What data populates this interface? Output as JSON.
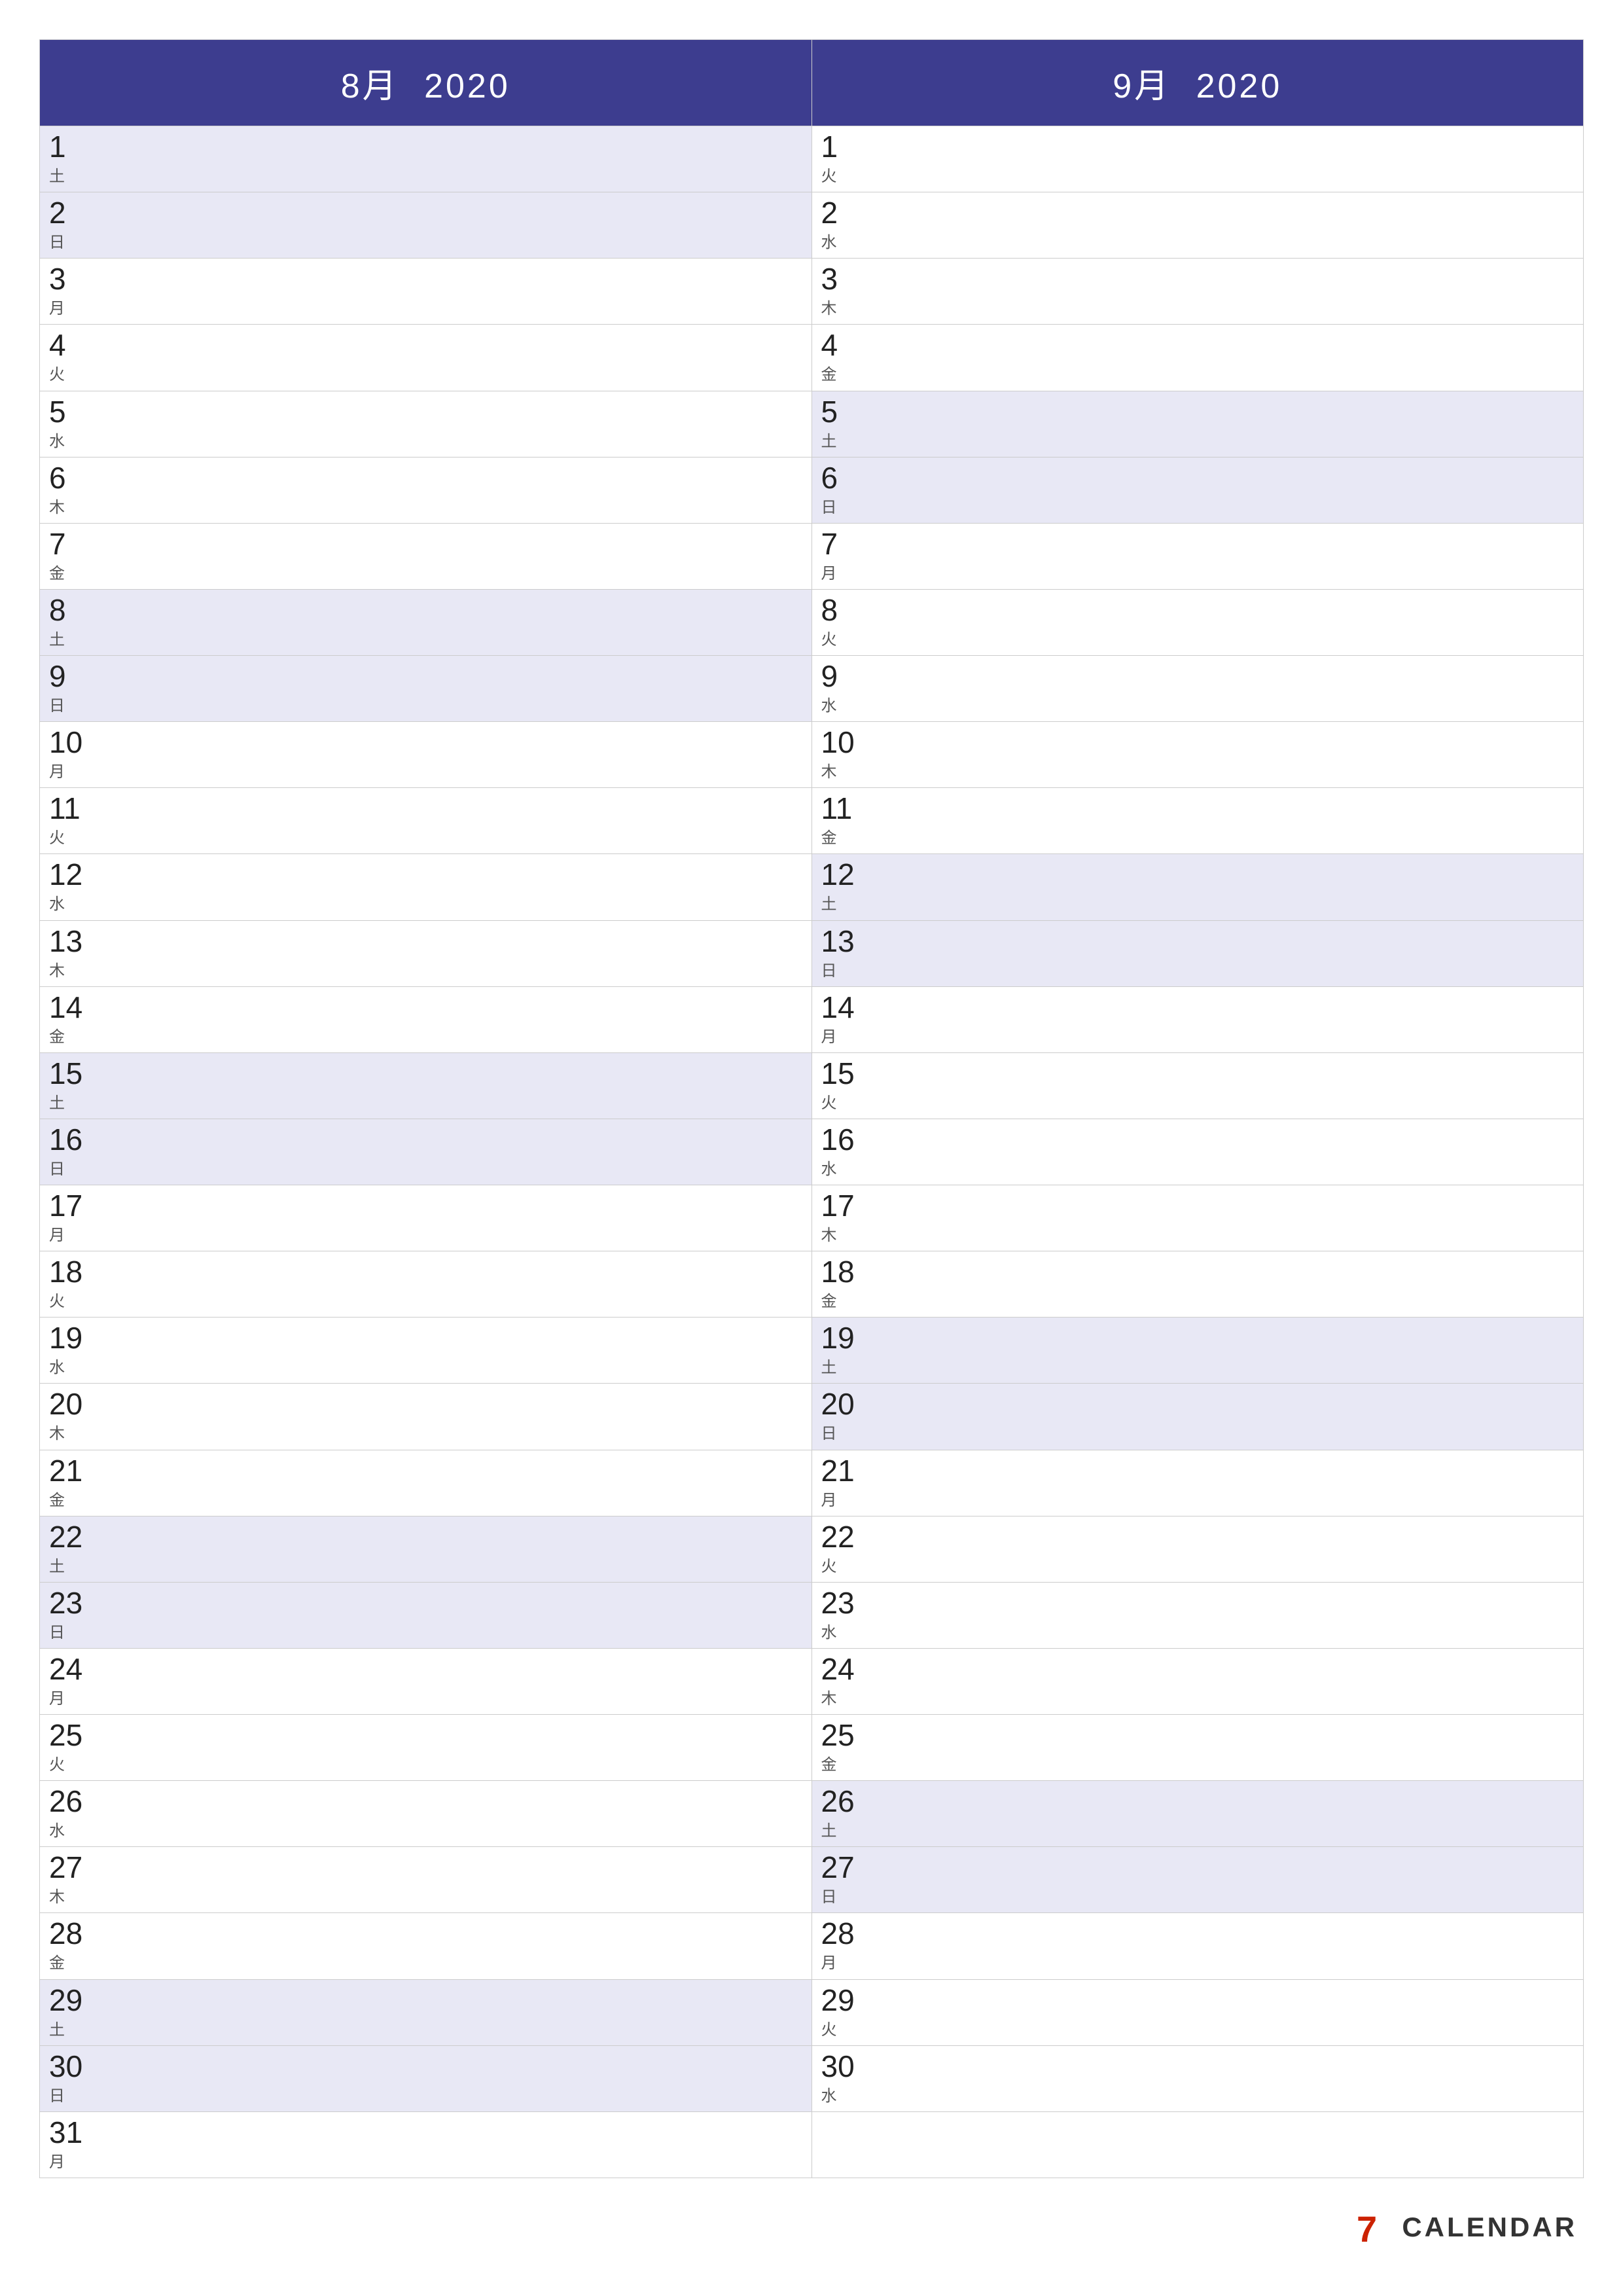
{
  "months": [
    {
      "label": "8月",
      "year": "2020",
      "days": [
        {
          "num": "1",
          "jp": "土",
          "weekend": true
        },
        {
          "num": "2",
          "jp": "日",
          "weekend": true
        },
        {
          "num": "3",
          "jp": "月",
          "weekend": false
        },
        {
          "num": "4",
          "jp": "火",
          "weekend": false
        },
        {
          "num": "5",
          "jp": "水",
          "weekend": false
        },
        {
          "num": "6",
          "jp": "木",
          "weekend": false
        },
        {
          "num": "7",
          "jp": "金",
          "weekend": false
        },
        {
          "num": "8",
          "jp": "土",
          "weekend": true
        },
        {
          "num": "9",
          "jp": "日",
          "weekend": true
        },
        {
          "num": "10",
          "jp": "月",
          "weekend": false
        },
        {
          "num": "11",
          "jp": "火",
          "weekend": false
        },
        {
          "num": "12",
          "jp": "水",
          "weekend": false
        },
        {
          "num": "13",
          "jp": "木",
          "weekend": false
        },
        {
          "num": "14",
          "jp": "金",
          "weekend": false
        },
        {
          "num": "15",
          "jp": "土",
          "weekend": true
        },
        {
          "num": "16",
          "jp": "日",
          "weekend": true
        },
        {
          "num": "17",
          "jp": "月",
          "weekend": false
        },
        {
          "num": "18",
          "jp": "火",
          "weekend": false
        },
        {
          "num": "19",
          "jp": "水",
          "weekend": false
        },
        {
          "num": "20",
          "jp": "木",
          "weekend": false
        },
        {
          "num": "21",
          "jp": "金",
          "weekend": false
        },
        {
          "num": "22",
          "jp": "土",
          "weekend": true
        },
        {
          "num": "23",
          "jp": "日",
          "weekend": true
        },
        {
          "num": "24",
          "jp": "月",
          "weekend": false
        },
        {
          "num": "25",
          "jp": "火",
          "weekend": false
        },
        {
          "num": "26",
          "jp": "水",
          "weekend": false
        },
        {
          "num": "27",
          "jp": "木",
          "weekend": false
        },
        {
          "num": "28",
          "jp": "金",
          "weekend": false
        },
        {
          "num": "29",
          "jp": "土",
          "weekend": true
        },
        {
          "num": "30",
          "jp": "日",
          "weekend": true
        },
        {
          "num": "31",
          "jp": "月",
          "weekend": false
        }
      ]
    },
    {
      "label": "9月",
      "year": "2020",
      "days": [
        {
          "num": "1",
          "jp": "火",
          "weekend": false
        },
        {
          "num": "2",
          "jp": "水",
          "weekend": false
        },
        {
          "num": "3",
          "jp": "木",
          "weekend": false
        },
        {
          "num": "4",
          "jp": "金",
          "weekend": false
        },
        {
          "num": "5",
          "jp": "土",
          "weekend": true
        },
        {
          "num": "6",
          "jp": "日",
          "weekend": true
        },
        {
          "num": "7",
          "jp": "月",
          "weekend": false
        },
        {
          "num": "8",
          "jp": "火",
          "weekend": false
        },
        {
          "num": "9",
          "jp": "水",
          "weekend": false
        },
        {
          "num": "10",
          "jp": "木",
          "weekend": false
        },
        {
          "num": "11",
          "jp": "金",
          "weekend": false
        },
        {
          "num": "12",
          "jp": "土",
          "weekend": true
        },
        {
          "num": "13",
          "jp": "日",
          "weekend": true
        },
        {
          "num": "14",
          "jp": "月",
          "weekend": false
        },
        {
          "num": "15",
          "jp": "火",
          "weekend": false
        },
        {
          "num": "16",
          "jp": "水",
          "weekend": false
        },
        {
          "num": "17",
          "jp": "木",
          "weekend": false
        },
        {
          "num": "18",
          "jp": "金",
          "weekend": false
        },
        {
          "num": "19",
          "jp": "土",
          "weekend": true
        },
        {
          "num": "20",
          "jp": "日",
          "weekend": true
        },
        {
          "num": "21",
          "jp": "月",
          "weekend": false
        },
        {
          "num": "22",
          "jp": "火",
          "weekend": false
        },
        {
          "num": "23",
          "jp": "水",
          "weekend": false
        },
        {
          "num": "24",
          "jp": "木",
          "weekend": false
        },
        {
          "num": "25",
          "jp": "金",
          "weekend": false
        },
        {
          "num": "26",
          "jp": "土",
          "weekend": true
        },
        {
          "num": "27",
          "jp": "日",
          "weekend": true
        },
        {
          "num": "28",
          "jp": "月",
          "weekend": false
        },
        {
          "num": "29",
          "jp": "火",
          "weekend": false
        },
        {
          "num": "30",
          "jp": "水",
          "weekend": false
        }
      ]
    }
  ],
  "brand": {
    "text": "CALENDAR",
    "icon_color": "#cc2200"
  }
}
